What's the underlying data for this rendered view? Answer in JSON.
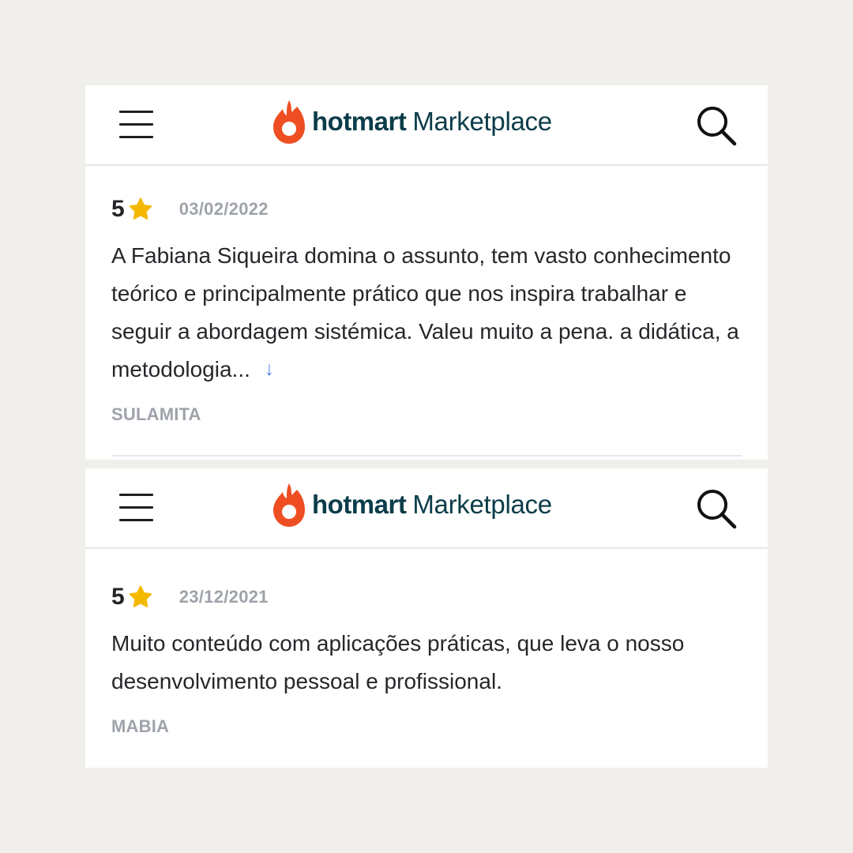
{
  "cards": [
    {
      "header": {
        "brand": "hotmart",
        "product": "Marketplace"
      },
      "review": {
        "rating": "5",
        "date": "03/02/2022",
        "text": "A Fabiana Siqueira domina o assunto, tem vasto conhecimento teórico e principalmente prático que nos inspira trabalhar e seguir a abordagem sistémica. Valeu muito a pena. a didática, a metodologia...",
        "expand_glyph": "↓",
        "reviewer": "SULAMITA"
      }
    },
    {
      "header": {
        "brand": "hotmart",
        "product": "Marketplace"
      },
      "review": {
        "rating": "5",
        "date": "23/12/2021",
        "text": "Muito conteúdo com aplicações práticas, que leva o nosso desenvolvimento pessoal e profissional.",
        "reviewer": "MABIA"
      }
    }
  ],
  "icons": {
    "menu": "menu-icon",
    "logo": "flame-icon",
    "search": "search-icon",
    "star": "star-icon",
    "expand": "arrow-down-icon"
  },
  "colors": {
    "background": "#f0efeb",
    "card": "#ffffff",
    "brand_text": "#0b3c49",
    "flame": "#ef4e23",
    "star": "#f5b800",
    "muted_text": "#9ea3aa",
    "body_text": "#26272b",
    "link": "#4f7ee6"
  }
}
